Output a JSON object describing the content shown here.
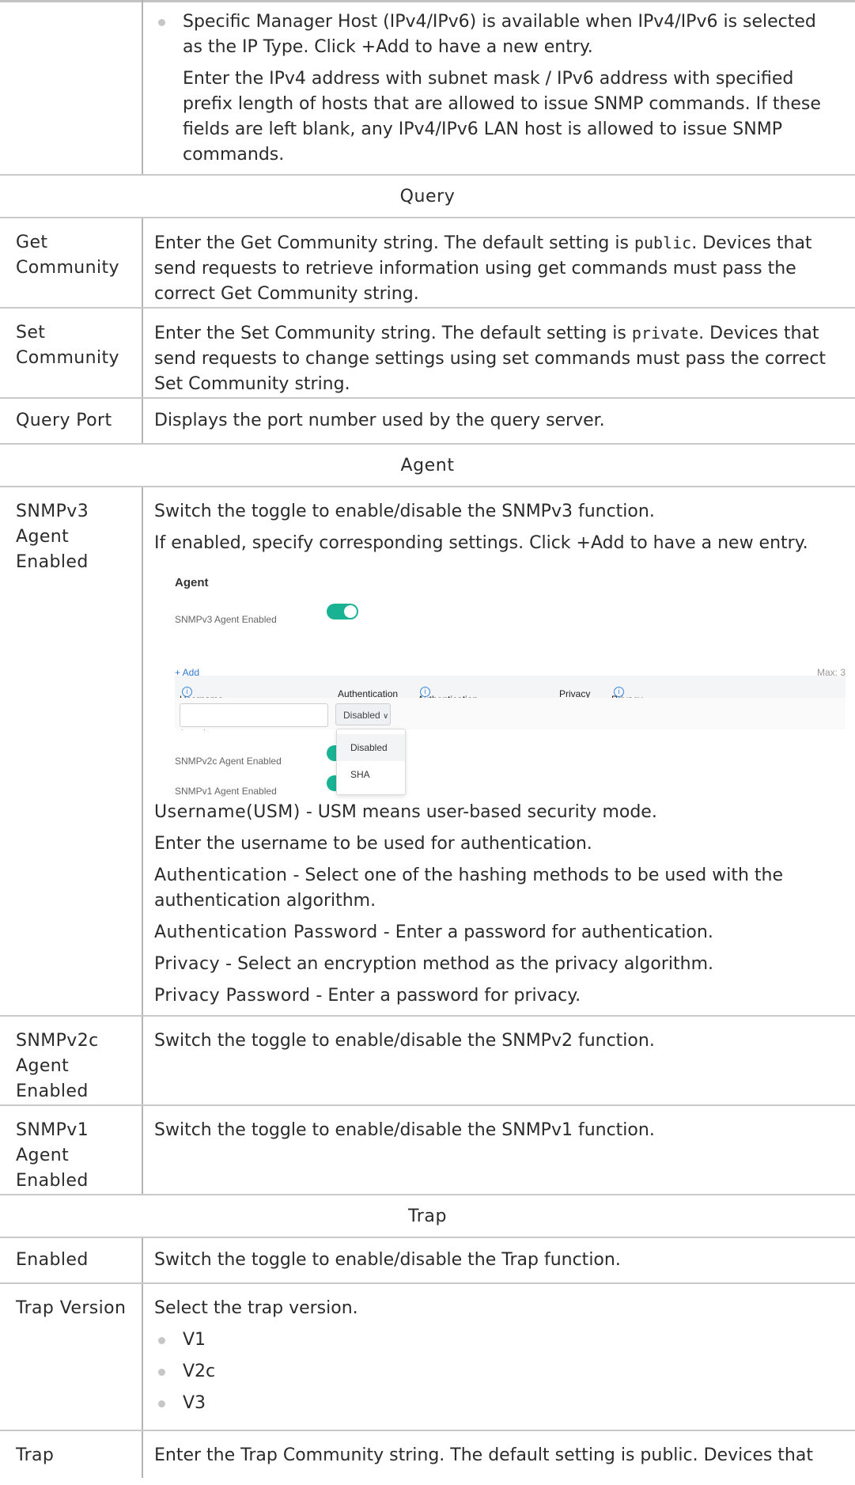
{
  "colors": {
    "accent_toggle": "#19b394",
    "link": "#2f78d6",
    "border": "#c9c9c9"
  },
  "top": {
    "bullet": "Specific Manager Host (IPv4/IPv6) is available when IPv4/IPv6 is selected as the IP Type. Click +Add to have a new entry.",
    "para": "Enter the IPv4 address with subnet mask / IPv6 address with specified prefix length of hosts that are allowed to issue SNMP commands. If these fields are left blank, any IPv4/IPv6 LAN host is allowed to issue SNMP commands."
  },
  "sections": {
    "query": "Query",
    "agent": "Agent",
    "trap": "Trap"
  },
  "query": {
    "get_label": "Get Community",
    "get_desc_a": "Enter the Get Community string. The default setting is ",
    "get_desc_val": "public",
    "get_desc_b": ". Devices that send requests to retrieve information using get commands must pass the correct Get Community string.",
    "set_label": "Set Community",
    "set_desc_a": "Enter the Set Community string. The default setting is ",
    "set_desc_val": "private",
    "set_desc_b": ". Devices that send requests to change settings using set commands must pass the correct Set Community string.",
    "port_label": "Query Port",
    "port_desc": "Displays the port number used by the query server."
  },
  "agent": {
    "v3_label": "SNMPv3 Agent Enabled",
    "v3_p1": "Switch the toggle to enable/disable the SNMPv3 function.",
    "v3_p2": "If enabled, specify corresponding settings. Click +Add to have a new entry.",
    "shot": {
      "title": "Agent",
      "v3": "SNMPv3 Agent Enabled",
      "add": "+ Add",
      "max": "Max: 3",
      "col_user": "Username (USM)",
      "col_auth": "Authentication",
      "col_authpw": "Authentication Password",
      "col_priv": "Privacy",
      "col_privpw": "Privacy Password",
      "auth_selected": "Disabled",
      "options": [
        "Disabled",
        "SHA"
      ],
      "v2c": "SNMPv2c Agent Enabled",
      "v1": "SNMPv1 Agent Enabled"
    },
    "f_user_lbl": "Username(USM)",
    "f_user_txt": " - USM means user-based security mode.",
    "f_user_p2": "Enter the username to be used for authentication.",
    "f_auth_lbl": "Authentication",
    "f_auth_txt": " - Select one of the hashing methods to be used with the authentication algorithm.",
    "f_authpw_lbl": "Authentication Password",
    "f_authpw_txt": " - Enter a password for authentication.",
    "f_priv_lbl": "Privacy",
    "f_priv_txt": " - Select an encryption method as the privacy algorithm.",
    "f_privpw_lbl": "Privacy Password",
    "f_privpw_txt": " - Enter a password for privacy.",
    "v2c_label": "SNMPv2c Agent Enabled",
    "v2c_desc": "Switch the toggle to enable/disable the SNMPv2 function.",
    "v1_label": "SNMPv1 Agent Enabled",
    "v1_desc": "Switch the toggle to enable/disable the SNMPv1 function."
  },
  "trap": {
    "enabled_label": "Enabled",
    "enabled_desc": "Switch the toggle to enable/disable the Trap function.",
    "version_label": "Trap Version",
    "version_desc": "Select the trap version.",
    "versions": [
      "V1",
      "V2c",
      "V3"
    ],
    "community_label": "Trap",
    "community_desc": "Enter the Trap Community string. The default setting is public. Devices that"
  }
}
